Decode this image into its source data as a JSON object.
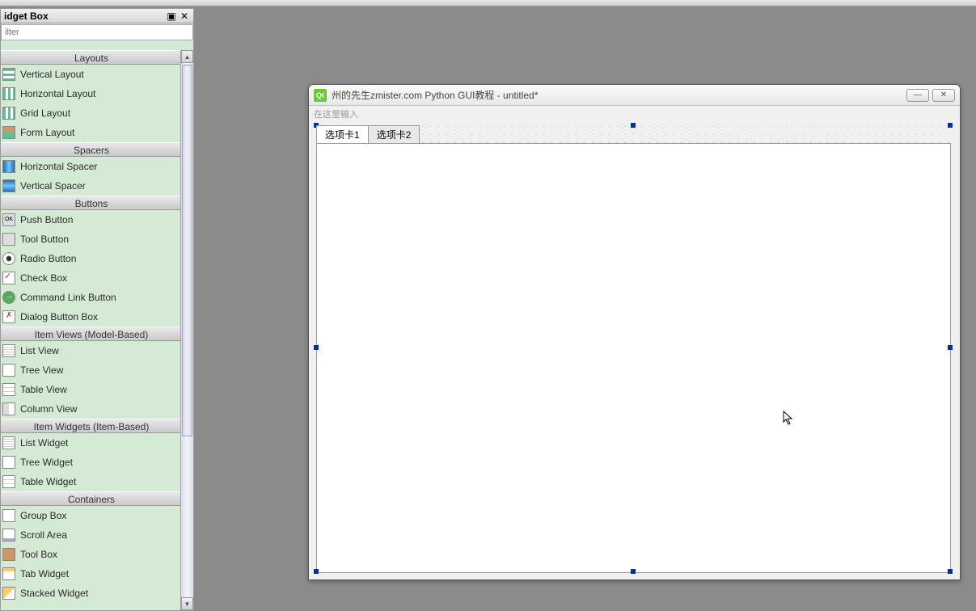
{
  "panel": {
    "title": "idget Box",
    "filter_placeholder": "ilter"
  },
  "sections": {
    "layouts": "Layouts",
    "spacers": "Spacers",
    "buttons": "Buttons",
    "itemviews": "Item Views (Model-Based)",
    "itemwidgets": "Item Widgets (Item-Based)",
    "containers": "Containers"
  },
  "widgets": {
    "vlayout": "Vertical Layout",
    "hlayout": "Horizontal Layout",
    "gridlayout": "Grid Layout",
    "formlayout": "Form Layout",
    "hspacer": "Horizontal Spacer",
    "vspacer": "Vertical Spacer",
    "pushbtn": "Push Button",
    "toolbtn": "Tool Button",
    "radiobtn": "Radio Button",
    "checkbox": "Check Box",
    "cmdlink": "Command Link Button",
    "dlgbtn": "Dialog Button Box",
    "listview": "List View",
    "treeview": "Tree View",
    "tableview": "Table View",
    "columnview": "Column View",
    "listwidget": "List Widget",
    "treewidget": "Tree Widget",
    "tablewidget": "Table Widget",
    "groupbox": "Group Box",
    "scrollarea": "Scroll Area",
    "toolbox": "Tool Box",
    "tabwidget": "Tab Widget",
    "stackedwidget": "Stacked Widget"
  },
  "form": {
    "title": "州的先生zmister.com Python GUI教程 - untitled*",
    "menu_hint": "在这里输入",
    "tab1": "选项卡1",
    "tab2": "选项卡2",
    "icon_text": "Qt"
  }
}
